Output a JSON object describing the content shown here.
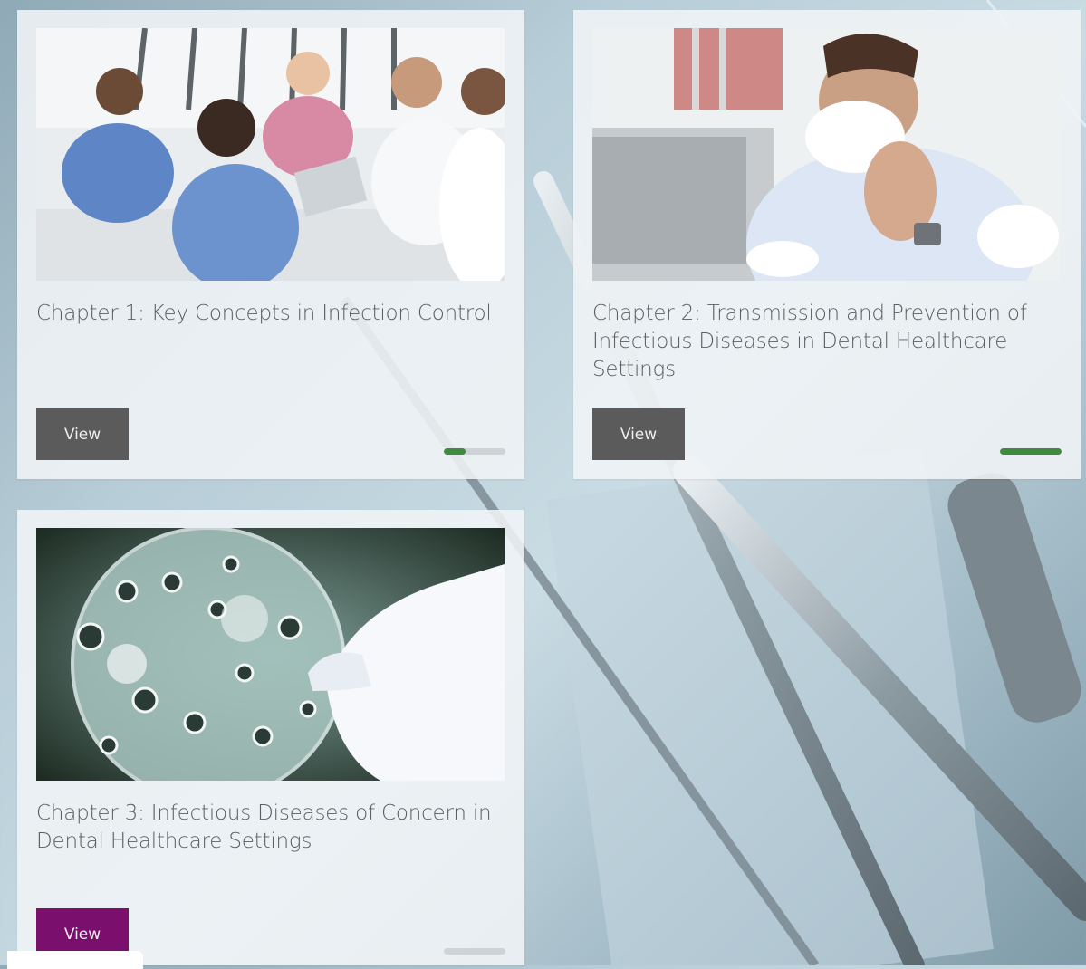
{
  "colors": {
    "view_button_default": "#5b5b5b",
    "view_button_active": "#7a0f6e",
    "progress_fill": "#3f8a3f",
    "progress_track": "#cfd3d5"
  },
  "chapters": [
    {
      "title": "Chapter 1: Key Concepts in Infection Control",
      "image": "healthcare-team-meeting-photo",
      "button_label": "View",
      "progress_fraction": 0.35
    },
    {
      "title": "Chapter 2: Transmission and Prevention of Infectious Diseases in Dental Healthcare Settings",
      "image": "man-sneezing-tissue-photo",
      "button_label": "View",
      "progress_fraction": 1.0
    },
    {
      "title": "Chapter 3: Infectious Diseases of Concern in Dental Healthcare Settings",
      "image": "petri-dish-bacteria-photo",
      "button_label": "View",
      "progress_fraction": 0.0
    }
  ]
}
